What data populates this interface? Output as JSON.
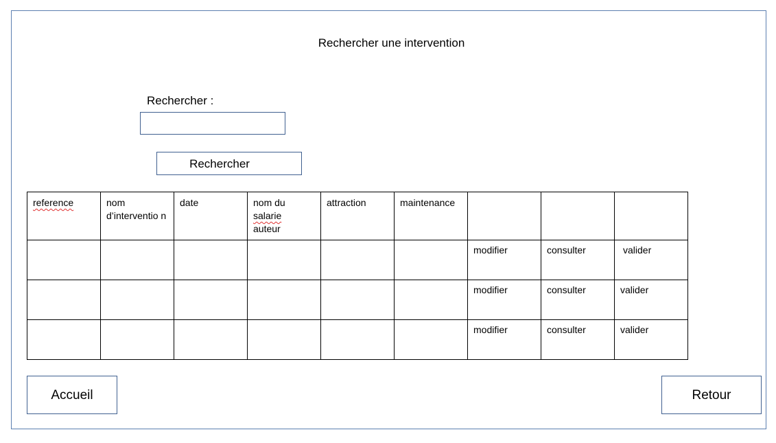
{
  "page": {
    "title": "Rechercher une intervention"
  },
  "search": {
    "label": "Rechercher :",
    "value": "",
    "placeholder": "",
    "button_label": "Rechercher"
  },
  "table": {
    "headers": [
      "reference",
      "nom d’interventio n",
      "date",
      "nom du salarie auteur",
      "attraction",
      "maintenance",
      "",
      "",
      ""
    ],
    "rows": [
      {
        "actions": [
          "modifier",
          "consulter",
          "valider"
        ]
      },
      {
        "actions": [
          "modifier",
          "consulter",
          "valider"
        ]
      },
      {
        "actions": [
          "modifier",
          "consulter",
          "valider"
        ]
      }
    ]
  },
  "footer": {
    "home_label": "Accueil",
    "back_label": "Retour"
  }
}
